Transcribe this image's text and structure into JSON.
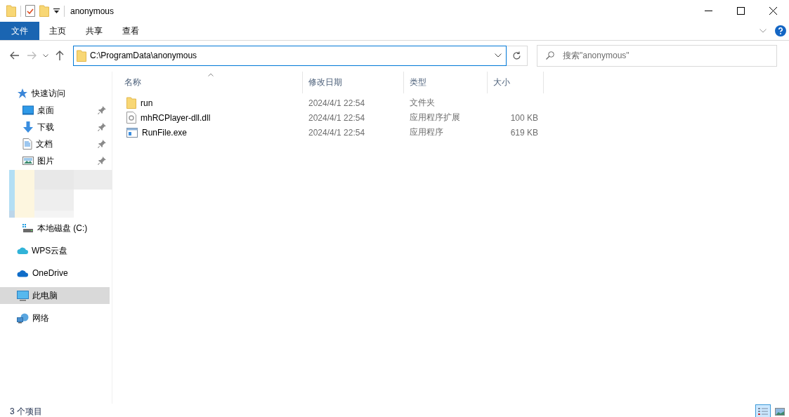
{
  "window": {
    "title": "anonymous"
  },
  "ribbon": {
    "tabs": [
      {
        "label": "文件",
        "kind": "file",
        "selected": true
      },
      {
        "label": "主页",
        "kind": "tab",
        "selected": false
      },
      {
        "label": "共享",
        "kind": "tab",
        "selected": false
      },
      {
        "label": "查看",
        "kind": "tab",
        "selected": false
      }
    ]
  },
  "address": {
    "value": "C:\\ProgramData\\anonymous"
  },
  "search": {
    "placeholder": "搜索\"anonymous\""
  },
  "sidebar": {
    "items": [
      {
        "label": "快速访问",
        "kind": "star",
        "selected": false,
        "children": [
          {
            "label": "桌面",
            "kind": "desktop",
            "pinned": true,
            "selected": false
          },
          {
            "label": "下载",
            "kind": "download",
            "pinned": true,
            "selected": false
          },
          {
            "label": "文档",
            "kind": "document",
            "pinned": true,
            "selected": false
          },
          {
            "label": "图片",
            "kind": "pictures",
            "pinned": true,
            "selected": false
          },
          {
            "kind": "redacted"
          },
          {
            "label": "本地磁盘 (C:)",
            "kind": "drive",
            "pinned": false,
            "selected": false
          }
        ]
      },
      {
        "label": "WPS云盘",
        "kind": "cloud-wps",
        "selected": false
      },
      {
        "label": "OneDrive",
        "kind": "cloud",
        "selected": false
      },
      {
        "label": "此电脑",
        "kind": "pc",
        "selected": true
      },
      {
        "label": "网络",
        "kind": "network",
        "selected": false
      }
    ]
  },
  "table": {
    "columns": [
      {
        "label": "名称",
        "sorted": true
      },
      {
        "label": "修改日期",
        "sorted": false
      },
      {
        "label": "类型",
        "sorted": false
      },
      {
        "label": "大小",
        "sorted": false
      }
    ],
    "rows": [
      {
        "name": "run",
        "kind": "folder",
        "modified": "2024/4/1 22:54",
        "type": "文件夹",
        "selected": false
      },
      {
        "name": "mhRCPlayer-dll.dll",
        "kind": "dll",
        "modified": "2024/4/1 22:54",
        "type": "应用程序扩展",
        "size": "100 KB",
        "selected": false
      },
      {
        "name": "RunFile.exe",
        "kind": "exe",
        "modified": "2024/4/1 22:54",
        "type": "应用程序",
        "size": "619 KB",
        "selected": false
      }
    ]
  },
  "status_bar": {
    "text": "3 个项目",
    "views": [
      {
        "kind": "details",
        "selected": true
      },
      {
        "kind": "thumbnails",
        "selected": false
      }
    ]
  }
}
